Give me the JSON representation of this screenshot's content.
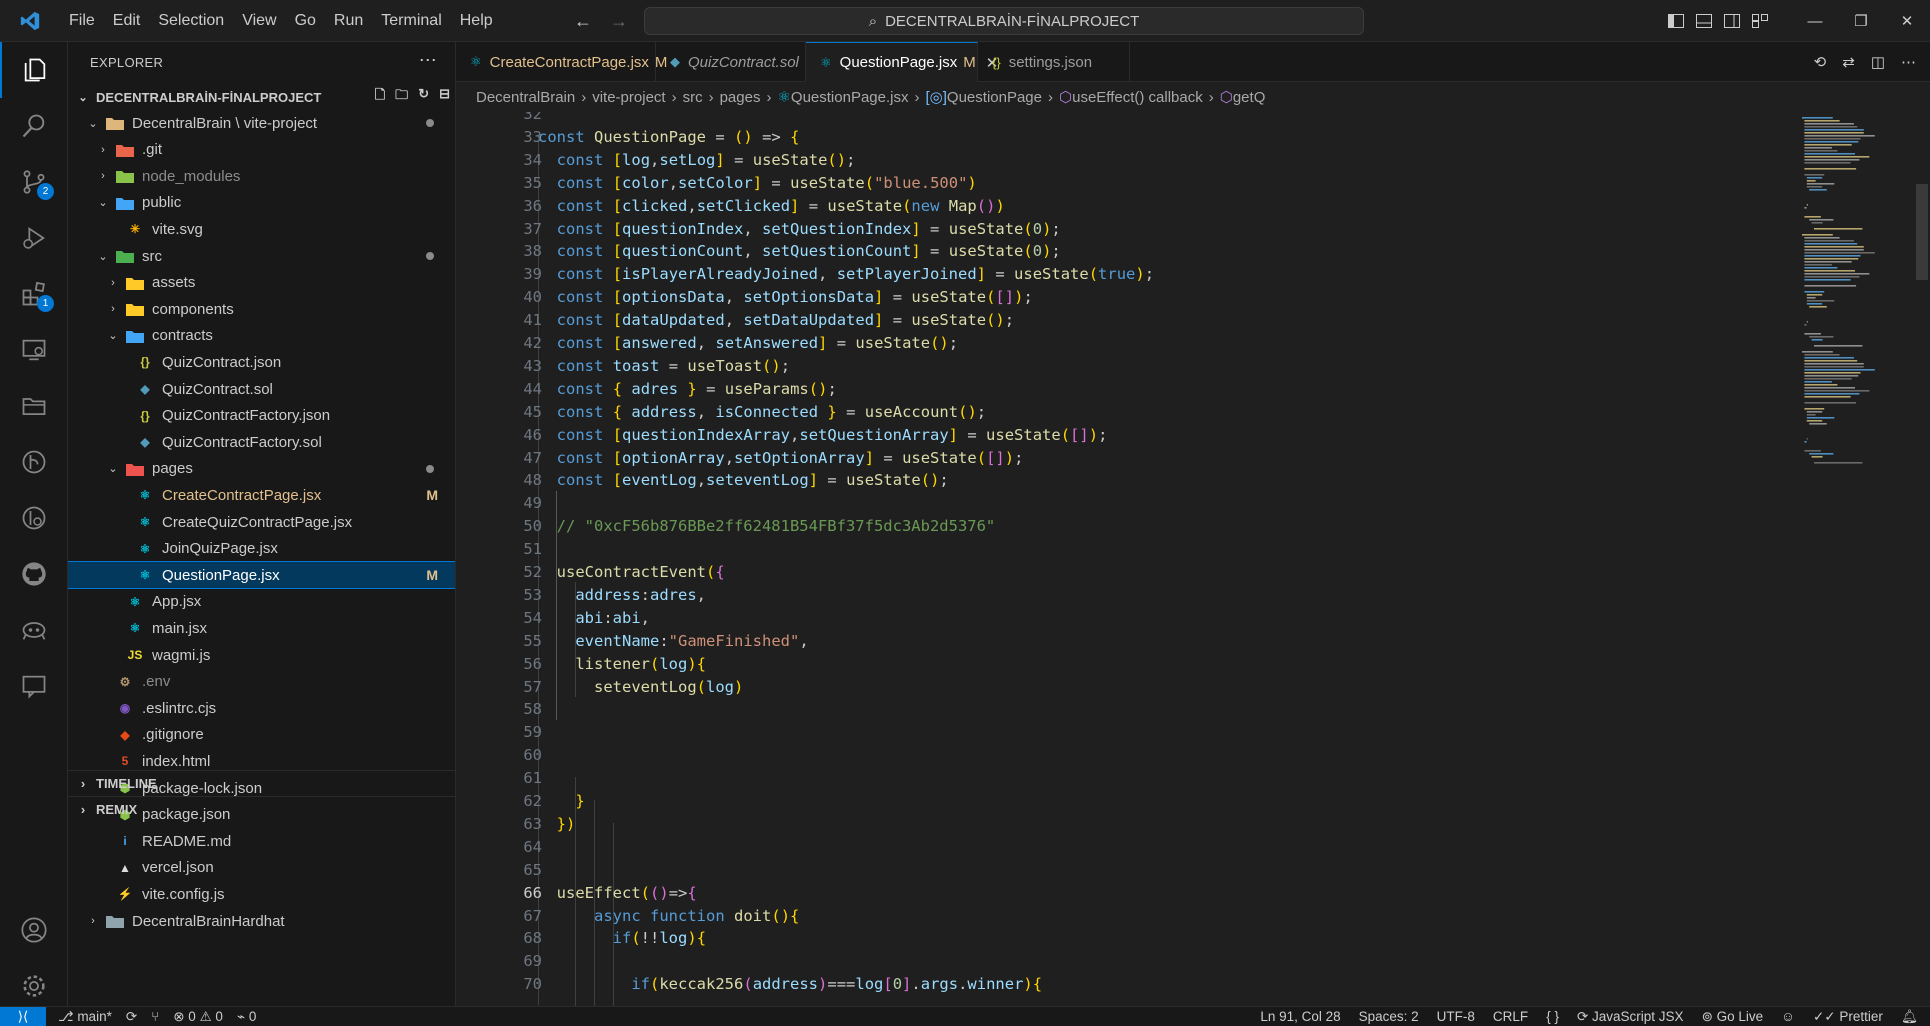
{
  "menu": [
    "File",
    "Edit",
    "Selection",
    "View",
    "Go",
    "Run",
    "Terminal",
    "Help"
  ],
  "search": {
    "label": "DECENTRALBRAİN-FİNALPROJECT"
  },
  "explorer": {
    "header": "EXPLORER",
    "workspace": "DECENTRALBRAİN-FİNALPROJECT",
    "tree": [
      {
        "label": "DecentralBrain \\ vite-project",
        "indent": 1,
        "type": "folder-open",
        "dot": true,
        "color": "#dcb67a"
      },
      {
        "label": ".git",
        "indent": 2,
        "type": "folder",
        "color": "#e8644b"
      },
      {
        "label": "node_modules",
        "indent": 2,
        "type": "folder",
        "color": "#8bc34a",
        "dim": true
      },
      {
        "label": "public",
        "indent": 2,
        "type": "folder-open",
        "color": "#42a5f5"
      },
      {
        "label": "vite.svg",
        "indent": 3,
        "type": "file",
        "icon": "✳",
        "color": "#ffb300"
      },
      {
        "label": "src",
        "indent": 2,
        "type": "folder-open",
        "dot": true,
        "color": "#4caf50"
      },
      {
        "label": "assets",
        "indent": 3,
        "type": "folder",
        "color": "#ffca28"
      },
      {
        "label": "components",
        "indent": 3,
        "type": "folder",
        "color": "#ffca28"
      },
      {
        "label": "contracts",
        "indent": 3,
        "type": "folder-open",
        "color": "#42a5f5"
      },
      {
        "label": "QuizContract.json",
        "indent": 4,
        "type": "file",
        "icon": "{}",
        "color": "#cbcb41"
      },
      {
        "label": "QuizContract.sol",
        "indent": 4,
        "type": "file",
        "icon": "◆",
        "color": "#519aba"
      },
      {
        "label": "QuizContractFactory.json",
        "indent": 4,
        "type": "file",
        "icon": "{}",
        "color": "#cbcb41"
      },
      {
        "label": "QuizContractFactory.sol",
        "indent": 4,
        "type": "file",
        "icon": "◆",
        "color": "#519aba"
      },
      {
        "label": "pages",
        "indent": 3,
        "type": "folder-open",
        "dot": true,
        "color": "#ef5350"
      },
      {
        "label": "CreateContractPage.jsx",
        "indent": 4,
        "type": "file",
        "icon": "⚛",
        "color": "#00bcd4",
        "status": "M",
        "modified": true
      },
      {
        "label": "CreateQuizContractPage.jsx",
        "indent": 4,
        "type": "file",
        "icon": "⚛",
        "color": "#00bcd4"
      },
      {
        "label": "JoinQuizPage.jsx",
        "indent": 4,
        "type": "file",
        "icon": "⚛",
        "color": "#00bcd4"
      },
      {
        "label": "QuestionPage.jsx",
        "indent": 4,
        "type": "file",
        "icon": "⚛",
        "color": "#00bcd4",
        "status": "M",
        "selected": true
      },
      {
        "label": "App.jsx",
        "indent": 3,
        "type": "file",
        "icon": "⚛",
        "color": "#00bcd4"
      },
      {
        "label": "main.jsx",
        "indent": 3,
        "type": "file",
        "icon": "⚛",
        "color": "#00bcd4"
      },
      {
        "label": "wagmi.js",
        "indent": 3,
        "type": "file",
        "icon": "JS",
        "color": "#f1dd35"
      },
      {
        "label": ".env",
        "indent": 2,
        "type": "file",
        "icon": "⚙",
        "color": "#b0956b",
        "dim": true
      },
      {
        "label": ".eslintrc.cjs",
        "indent": 2,
        "type": "file",
        "icon": "◉",
        "color": "#7e57c2"
      },
      {
        "label": ".gitignore",
        "indent": 2,
        "type": "file",
        "icon": "◆",
        "color": "#e64a19"
      },
      {
        "label": "index.html",
        "indent": 2,
        "type": "file",
        "icon": "5",
        "color": "#e44d26"
      },
      {
        "label": "package-lock.json",
        "indent": 2,
        "type": "file",
        "icon": "⬢",
        "color": "#8bc34a"
      },
      {
        "label": "package.json",
        "indent": 2,
        "type": "file",
        "icon": "⬢",
        "color": "#8bc34a"
      },
      {
        "label": "README.md",
        "indent": 2,
        "type": "file",
        "icon": "i",
        "color": "#42a5f5"
      },
      {
        "label": "vercel.json",
        "indent": 2,
        "type": "file",
        "icon": "▲",
        "color": "#dddddd"
      },
      {
        "label": "vite.config.js",
        "indent": 2,
        "type": "file",
        "icon": "⚡",
        "color": "#ffc107"
      },
      {
        "label": "DecentralBrainHardhat",
        "indent": 1,
        "type": "folder",
        "color": "#90a4ae"
      }
    ],
    "sections": [
      "TIMELINE",
      "REMIX"
    ]
  },
  "tabs": [
    {
      "label": "CreateContractPage.jsx",
      "status": "M",
      "icon": "⚛",
      "color": "#00bcd4",
      "italic": false
    },
    {
      "label": "QuizContract.sol",
      "status": "",
      "icon": "◆",
      "color": "#519aba",
      "italic": true
    },
    {
      "label": "QuestionPage.jsx",
      "status": "M",
      "icon": "⚛",
      "color": "#00bcd4",
      "active": true
    },
    {
      "label": "settings.json",
      "status": "",
      "icon": "{}",
      "color": "#cbcb41"
    }
  ],
  "breadcrumb": [
    "DecentralBrain",
    "vite-project",
    "src",
    "pages",
    "QuestionPage.jsx",
    "QuestionPage",
    "useEffect() callback",
    "getQ"
  ],
  "code": [
    {
      "n": "32",
      "t": ""
    },
    {
      "n": "33",
      "t": "const QuestionPage = () => {"
    },
    {
      "n": "34",
      "t": "  const [log,setLog] = useState();"
    },
    {
      "n": "35",
      "t": "  const [color,setColor] = useState(\"blue.500\")"
    },
    {
      "n": "36",
      "t": "  const [clicked,setClicked] = useState(new Map())"
    },
    {
      "n": "37",
      "t": "  const [questionIndex, setQuestionIndex] = useState(0);"
    },
    {
      "n": "38",
      "t": "  const [questionCount, setQuestionCount] = useState(0);"
    },
    {
      "n": "39",
      "t": "  const [isPlayerAlreadyJoined, setPlayerJoined] = useState(true);"
    },
    {
      "n": "40",
      "t": "  const [optionsData, setOptionsData] = useState([]);"
    },
    {
      "n": "41",
      "t": "  const [dataUpdated, setDataUpdated] = useState();"
    },
    {
      "n": "42",
      "t": "  const [answered, setAnswered] = useState();"
    },
    {
      "n": "43",
      "t": "  const toast = useToast();"
    },
    {
      "n": "44",
      "t": "  const { adres } = useParams();"
    },
    {
      "n": "45",
      "t": "  const { address, isConnected } = useAccount();"
    },
    {
      "n": "46",
      "t": "  const [questionIndexArray,setQuestionArray] = useState([]);"
    },
    {
      "n": "47",
      "t": "  const [optionArray,setOptionArray] = useState([]);"
    },
    {
      "n": "48",
      "t": "  const [eventLog,seteventLog] = useState();"
    },
    {
      "n": "49",
      "t": ""
    },
    {
      "n": "50",
      "t": "  // \"0xcF56b876BBe2ff62481B54FBf37f5dc3Ab2d5376\""
    },
    {
      "n": "51",
      "t": ""
    },
    {
      "n": "52",
      "t": "  useContractEvent({"
    },
    {
      "n": "53",
      "t": "    address:adres,"
    },
    {
      "n": "54",
      "t": "    abi:abi,"
    },
    {
      "n": "55",
      "t": "    eventName:\"GameFinished\","
    },
    {
      "n": "56",
      "t": "    listener(log){"
    },
    {
      "n": "57",
      "t": "      seteventLog(log)"
    },
    {
      "n": "58",
      "t": ""
    },
    {
      "n": "59",
      "t": ""
    },
    {
      "n": "60",
      "t": ""
    },
    {
      "n": "61",
      "t": ""
    },
    {
      "n": "62",
      "t": "    }"
    },
    {
      "n": "63",
      "t": "  })"
    },
    {
      "n": "64",
      "t": ""
    },
    {
      "n": "65",
      "t": ""
    },
    {
      "n": "66",
      "t": "  useEffect(()=>{"
    },
    {
      "n": "67",
      "t": "      async function doit(){"
    },
    {
      "n": "68",
      "t": "        if(!!log){"
    },
    {
      "n": "69",
      "t": ""
    },
    {
      "n": "70",
      "t": "          if(keccak256(address)===log[0].args.winner){"
    }
  ],
  "statusbar": {
    "branch": "main*",
    "problems": "⊗ 0 ⚠ 0",
    "ports": "0",
    "position": "Ln 91, Col 28",
    "spaces": "Spaces: 2",
    "encoding": "UTF-8",
    "eol": "CRLF",
    "braces": "{ }",
    "language": "JavaScript JSX",
    "golive": "Go Live",
    "prettier": "Prettier"
  },
  "badges": {
    "scm": "2",
    "extensions": "1"
  }
}
